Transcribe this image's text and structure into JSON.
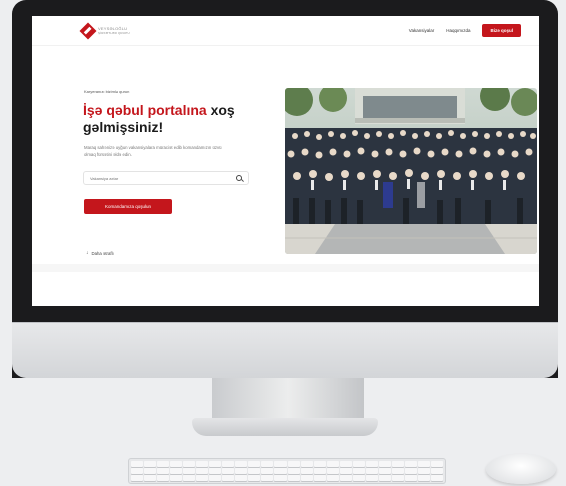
{
  "site": {
    "logo_text_line1": "VEYSƏLOĞLU",
    "logo_text_line2": "ŞİRKƏTLƏR QRUPU",
    "nav": {
      "links": [
        "Vakansiyalar",
        "Haqqımızda"
      ],
      "cta": "Bizə qoşul"
    },
    "hero": {
      "tagline": "Karyeranızı bizimlə qurun",
      "headline_red": "İşə qəbul portalına",
      "headline_dark_1": " xoş",
      "headline_dark_2": "gəlmişsiniz!",
      "description": "Maraq sahənizə uyğun vakansiyalara müraciət edib komandamızın üzvü olmaq fürsətini əldə edin.",
      "search_placeholder": "Vakansiya axtar",
      "join_button": "Komandamıza qoşulun",
      "more_link": "Daha ətraflı"
    }
  },
  "colors": {
    "brand_red": "#c4161c",
    "monitor_bezel": "#1b1b1d",
    "background": "#edeef0"
  },
  "icons": [
    "logo-diamond-icon",
    "search-icon",
    "arrow-down-icon"
  ]
}
